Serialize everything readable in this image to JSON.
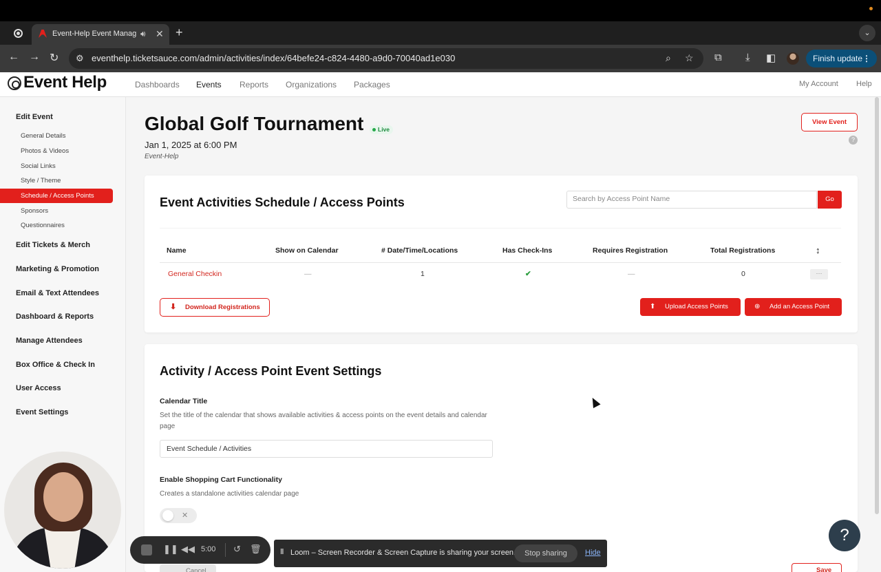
{
  "browser": {
    "tab_title": "Event-Help Event Manage",
    "url": "eventhelp.ticketsauce.com/admin/activities/index/64befe24-c824-4480-a9d0-70040ad1e030",
    "finish_update_label": "Finish update"
  },
  "header": {
    "logo": "Event Help",
    "nav": [
      "Dashboards",
      "Events",
      "Reports",
      "Organizations",
      "Packages"
    ],
    "active_nav": "Events",
    "right": [
      "My Account",
      "Help"
    ]
  },
  "sidebar": {
    "edit_event_heading": "Edit Event",
    "sub_items": [
      "General Details",
      "Photos & Videos",
      "Social Links",
      "Style / Theme",
      "Schedule / Access Points",
      "Sponsors",
      "Questionnaires"
    ],
    "active_item": "Schedule / Access Points",
    "sections": [
      "Edit Tickets & Merch",
      "Marketing & Promotion",
      "Email & Text Attendees",
      "Dashboard & Reports",
      "Manage Attendees",
      "Box Office & Check In",
      "User Access",
      "Event Settings"
    ]
  },
  "event": {
    "title": "Global Golf Tournament",
    "status": "Live",
    "date": "Jan 1, 2025 at 6:00 PM",
    "organization": "Event-Help",
    "view_button": "View Event"
  },
  "activities": {
    "title": "Event Activities Schedule / Access Points",
    "search_placeholder": "Search by Access Point Name",
    "go_label": "Go",
    "columns": [
      "Name",
      "Show on Calendar",
      "# Date/Time/Locations",
      "Has Check-Ins",
      "Requires Registration",
      "Total Registrations"
    ],
    "rows": [
      {
        "name": "General Checkin",
        "show_on_calendar": "—",
        "locations": "1",
        "has_checkins": "✔",
        "requires_registration": "—",
        "total_registrations": "0"
      }
    ],
    "download_label": "Download Registrations",
    "upload_label": "Upload Access Points",
    "add_label": "Add an Access Point"
  },
  "settings": {
    "title": "Activity / Access Point Event Settings",
    "calendar_title_label": "Calendar Title",
    "calendar_title_help": "Set the title of the calendar that shows available activities & access points on the event details and calendar page",
    "calendar_title_value": "Event Schedule / Activities",
    "cart_label": "Enable Shopping Cart Functionality",
    "cart_help": "Creates a standalone activities calendar page",
    "cart_enabled": false,
    "cancel_label": "Cancel",
    "save_label": "Save"
  },
  "recorder": {
    "time": "5:00"
  },
  "share_banner": {
    "message": "Loom – Screen Recorder & Screen Capture is sharing your screen.",
    "stop_label": "Stop sharing",
    "hide_label": "Hide"
  },
  "help_fab": "?",
  "colors": {
    "brand_red": "#e2201c",
    "live_green": "#27a84a",
    "check_green": "#2a9d3d"
  }
}
